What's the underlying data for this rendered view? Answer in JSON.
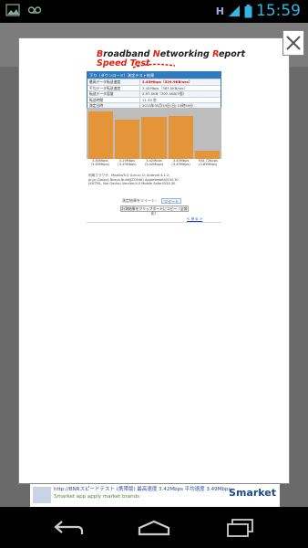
{
  "status_bar": {
    "network": "H",
    "time": "15:59"
  },
  "report": {
    "logo_title_parts": [
      "B",
      "roadband ",
      "N",
      "etworking ",
      "R",
      "eport"
    ],
    "logo_sub": "Speed Test",
    "table_header": "下り（ダウンロード）測定テスト結果",
    "rows": [
      {
        "key": "最高データ転送速度",
        "value": "3.85Mbps（529.9KB/sec）",
        "highlight": true
      },
      {
        "key": "平均データ転送速度",
        "value": "3.42Mbps（383.0KB/sec）",
        "highlight": false
      },
      {
        "key": "転送データ容量",
        "value": "2.97.5KB（307.4KB/7個）",
        "highlight": false
      },
      {
        "key": "転送時間",
        "value": "11.34 秒",
        "highlight": false
      },
      {
        "key": "測定日時",
        "value": "2013年05月19日(日) 15時59分",
        "highlight": false
      }
    ],
    "chart_data": {
      "type": "bar",
      "categories": [
        "1",
        "2",
        "3",
        "4",
        "5"
      ],
      "values": [
        3.85,
        3.19,
        3.42,
        3.45,
        0.7
      ],
      "ylim": [
        0,
        4.0
      ],
      "labels": [
        [
          "3.85Mbps",
          "(3.85Mbps)"
        ],
        [
          "3.19Mbps",
          "(3.19Mbps)"
        ],
        [
          "3.42Mbps",
          "(3.42Mbps)"
        ],
        [
          "3.45Mbps",
          "(3.45Mbps)"
        ],
        [
          "934.72Kbps",
          "(3.85Mbps)"
        ]
      ]
    },
    "env_lines": [
      "利用ブラウザ：Mozilla/5.0 (Linux; U; Android 4.1.2;",
      "ja-jp; Galaxy Nexus Build/JZO54K) AppleWebKit/534.30",
      "(KHTML, like Gecko) Version/4.0 Mobile Safari/534.30"
    ],
    "share_label": "測定結果をツイート：",
    "tweet_label": "ツイート",
    "copy_label": "計測結果をクリップボードにコピー（全角化）",
    "back_link": "< 戻る >"
  },
  "ad": {
    "title": "http://BNRスピードテスト (携帯版) 最高速度 3.42Mbps 平均速度 3.49Mbps",
    "sub": "Smarket app apply market brands",
    "logo": "Smarket"
  },
  "colors": {
    "bar": "#e4953a",
    "chart_bg": "#bdbdbd",
    "table_header": "#2f7bbd",
    "status_accent": "#33b5e5"
  }
}
